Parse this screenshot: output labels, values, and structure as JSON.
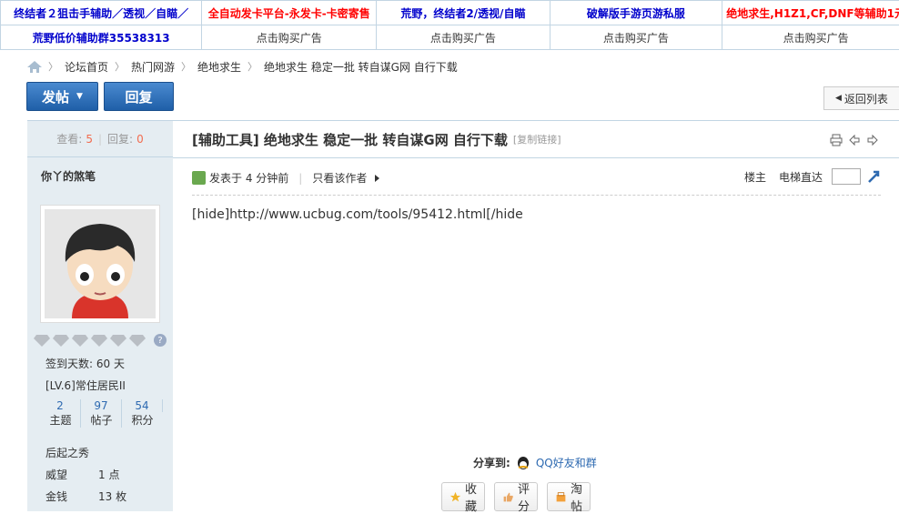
{
  "ads": {
    "row1": [
      {
        "text": "终结者２狙击手辅助／透视／自瞄／",
        "color": "#0000cc"
      },
      {
        "text": "全自动发卡平台-永发卡-卡密寄售",
        "color": "#ff0000"
      },
      {
        "text": "荒野，终结者2/透视/自瞄",
        "color": "#0000cc"
      },
      {
        "text": "破解版手游页游私服",
        "color": "#0000cc"
      },
      {
        "text": "绝地求生,H1Z1,CF,DNF等辅助1元",
        "color": "#ff0000"
      }
    ],
    "row2": [
      {
        "text": "荒野低价辅助群35538313",
        "color": "#0000cc"
      },
      {
        "text": "点击购买广告"
      },
      {
        "text": "点击购买广告"
      },
      {
        "text": "点击购买广告"
      },
      {
        "text": "点击购买广告"
      }
    ]
  },
  "breadcrumb": [
    "论坛首页",
    "热门网游",
    "绝地求生",
    "绝地求生 稳定一批 转自谋G网 自行下载"
  ],
  "buttons": {
    "post": "发帖",
    "reply": "回复",
    "back": "返回列表"
  },
  "sidebar": {
    "view_label": "查看:",
    "view_count": "5",
    "reply_label": "回复:",
    "reply_count": "0",
    "author": "你丫的煞笔",
    "sign_days": "签到天数: 60 天",
    "level": "[LV.6]常住居民II",
    "stats": [
      {
        "v": "2",
        "l": "主题"
      },
      {
        "v": "97",
        "l": "帖子"
      },
      {
        "v": "54",
        "l": "积分"
      }
    ],
    "rank": "后起之秀",
    "props": [
      {
        "k": "威望",
        "v": "1 点"
      },
      {
        "k": "金钱",
        "v": "13 枚"
      }
    ]
  },
  "post": {
    "title": "[辅助工具] 绝地求生 稳定一批 转自谋G网 自行下载",
    "copy_link": "[复制链接]",
    "posted": "发表于 4 分钟前",
    "only_author": "只看该作者",
    "floor": "楼主",
    "elevator": "电梯直达",
    "content": "[hide]http://www.ucbug.com/tools/95412.html[/hide",
    "share_label": "分享到:",
    "share_qq": "QQ好友和群",
    "actions": [
      "收藏",
      "评分",
      "淘帖"
    ]
  },
  "colors": {
    "blue_button": "#2a6cb8",
    "link": "#2e6ab1",
    "sidebar_bg": "#e5edf2",
    "border": "#c2d5e3"
  }
}
